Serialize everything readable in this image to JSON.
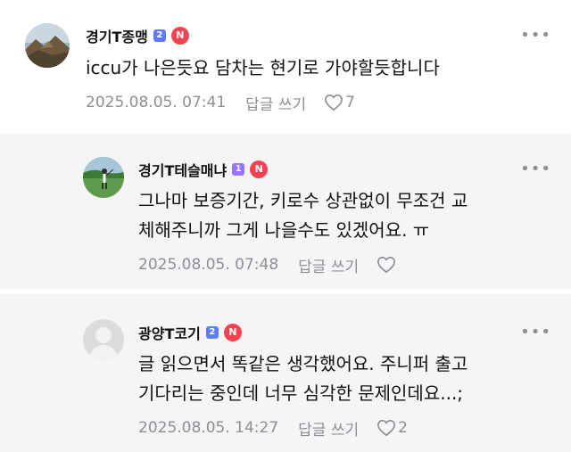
{
  "colors": {
    "reply_bg": "#f5f5f7",
    "level_badge": "#7b6cf6",
    "n_badge": "#f04452",
    "meta_text": "#8e8e93"
  },
  "comments": [
    {
      "author": "경기T종맹",
      "level": "2",
      "level_color": "#5c7cfa",
      "badge": "N",
      "text_lines": [
        "iccu가 나은듯요 담차는 현기로 가야할듯합니다"
      ],
      "timestamp": "2025.08.05. 07:41",
      "reply_label": "답글 쓰기",
      "like_icon": "heart-outline-icon",
      "likes": "7",
      "more_icon": "more-dots-icon",
      "avatar": "mountain-landscape-photo"
    },
    {
      "author": "경기T테슬매냐",
      "level": "1",
      "level_color": "#9775fa",
      "badge": "N",
      "text_lines": [
        "그나마 보증기간, 키로수 상관없이 무조건 교",
        "체해주니까 그게 나을수도 있겠어요. ㅠ"
      ],
      "timestamp": "2025.08.05. 07:48",
      "reply_label": "답글 쓰기",
      "like_icon": "heart-outline-icon",
      "likes": "",
      "more_icon": "more-dots-icon",
      "avatar": "golf-course-photo"
    },
    {
      "author": "광양T코기",
      "level": "2",
      "level_color": "#5c7cfa",
      "badge": "N",
      "text_lines": [
        "글 읽으면서 똑같은 생각했어요. 주니퍼 출고",
        "기다리는 중인데 너무 심각한 문제인데요...;"
      ],
      "timestamp": "2025.08.05. 14:27",
      "reply_label": "답글 쓰기",
      "like_icon": "heart-outline-icon",
      "likes": "2",
      "more_icon": "more-dots-icon",
      "avatar": "default-profile-avatar"
    }
  ]
}
